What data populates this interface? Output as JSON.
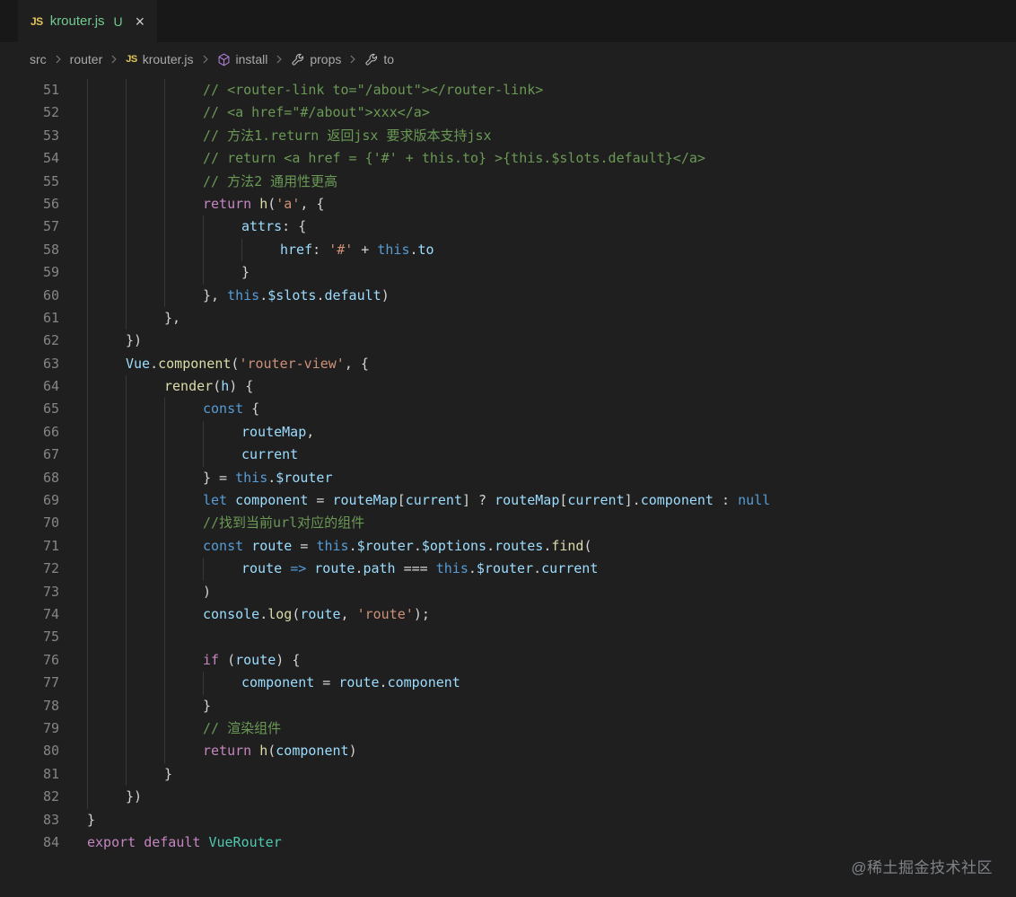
{
  "tab": {
    "icon_label": "JS",
    "title": "krouter.js",
    "git_badge": "U",
    "close_glyph": "×"
  },
  "breadcrumbs": [
    {
      "label": "src",
      "icon": null
    },
    {
      "label": "router",
      "icon": null
    },
    {
      "label": "krouter.js",
      "icon": "js"
    },
    {
      "label": "install",
      "icon": "cube"
    },
    {
      "label": "props",
      "icon": "wrench"
    },
    {
      "label": "to",
      "icon": "wrench"
    }
  ],
  "editor": {
    "first_line": 51,
    "last_line": 84,
    "lines": [
      {
        "n": 51,
        "i": 3,
        "t": [
          [
            "c",
            "// <router-link to=\"/about\"></router-link>"
          ]
        ]
      },
      {
        "n": 52,
        "i": 3,
        "t": [
          [
            "c",
            "// <a href=\"#/about\">xxx</a>"
          ]
        ]
      },
      {
        "n": 53,
        "i": 3,
        "t": [
          [
            "c",
            "// 方法1.return 返回jsx 要求版本支持jsx"
          ]
        ]
      },
      {
        "n": 54,
        "i": 3,
        "t": [
          [
            "c",
            "// return <a href = {'#' + this.to} >{this.$slots.default}</a>"
          ]
        ]
      },
      {
        "n": 55,
        "i": 3,
        "t": [
          [
            "c",
            "// 方法2 通用性更高"
          ]
        ]
      },
      {
        "n": 56,
        "i": 3,
        "t": [
          [
            "k",
            "return"
          ],
          [
            "p",
            " "
          ],
          [
            "f",
            "h"
          ],
          [
            "p",
            "("
          ],
          [
            "r",
            "'a'"
          ],
          [
            "p",
            ", {"
          ]
        ]
      },
      {
        "n": 57,
        "i": 4,
        "t": [
          [
            "v",
            "attrs"
          ],
          [
            "p",
            ": {"
          ]
        ]
      },
      {
        "n": 58,
        "i": 5,
        "t": [
          [
            "v",
            "href"
          ],
          [
            "p",
            ": "
          ],
          [
            "r",
            "'#'"
          ],
          [
            "p",
            " + "
          ],
          [
            "s",
            "this"
          ],
          [
            "p",
            "."
          ],
          [
            "v",
            "to"
          ]
        ]
      },
      {
        "n": 59,
        "i": 4,
        "t": [
          [
            "p",
            "}"
          ]
        ]
      },
      {
        "n": 60,
        "i": 3,
        "t": [
          [
            "p",
            "}, "
          ],
          [
            "s",
            "this"
          ],
          [
            "p",
            "."
          ],
          [
            "v",
            "$slots"
          ],
          [
            "p",
            "."
          ],
          [
            "v",
            "default"
          ],
          [
            "p",
            ")"
          ]
        ]
      },
      {
        "n": 61,
        "i": 2,
        "t": [
          [
            "p",
            "},"
          ]
        ]
      },
      {
        "n": 62,
        "i": 1,
        "t": [
          [
            "p",
            "})"
          ]
        ]
      },
      {
        "n": 63,
        "i": 1,
        "t": [
          [
            "v",
            "Vue"
          ],
          [
            "p",
            "."
          ],
          [
            "f",
            "component"
          ],
          [
            "p",
            "("
          ],
          [
            "r",
            "'router-view'"
          ],
          [
            "p",
            ", {"
          ]
        ]
      },
      {
        "n": 64,
        "i": 2,
        "t": [
          [
            "f",
            "render"
          ],
          [
            "p",
            "("
          ],
          [
            "v",
            "h"
          ],
          [
            "p",
            ") {"
          ]
        ]
      },
      {
        "n": 65,
        "i": 3,
        "t": [
          [
            "s",
            "const"
          ],
          [
            "p",
            " {"
          ]
        ]
      },
      {
        "n": 66,
        "i": 4,
        "t": [
          [
            "v",
            "routeMap"
          ],
          [
            "p",
            ","
          ]
        ]
      },
      {
        "n": 67,
        "i": 4,
        "t": [
          [
            "v",
            "current"
          ]
        ]
      },
      {
        "n": 68,
        "i": 3,
        "t": [
          [
            "p",
            "} = "
          ],
          [
            "s",
            "this"
          ],
          [
            "p",
            "."
          ],
          [
            "v",
            "$router"
          ]
        ]
      },
      {
        "n": 69,
        "i": 3,
        "t": [
          [
            "s",
            "let"
          ],
          [
            "p",
            " "
          ],
          [
            "v",
            "component"
          ],
          [
            "p",
            " = "
          ],
          [
            "v",
            "routeMap"
          ],
          [
            "p",
            "["
          ],
          [
            "v",
            "current"
          ],
          [
            "p",
            "] ? "
          ],
          [
            "v",
            "routeMap"
          ],
          [
            "p",
            "["
          ],
          [
            "v",
            "current"
          ],
          [
            "p",
            "]."
          ],
          [
            "v",
            "component"
          ],
          [
            "p",
            " : "
          ],
          [
            "s",
            "null"
          ]
        ]
      },
      {
        "n": 70,
        "i": 3,
        "t": [
          [
            "c",
            "//找到当前url对应的组件"
          ]
        ]
      },
      {
        "n": 71,
        "i": 3,
        "t": [
          [
            "s",
            "const"
          ],
          [
            "p",
            " "
          ],
          [
            "v",
            "route"
          ],
          [
            "p",
            " = "
          ],
          [
            "s",
            "this"
          ],
          [
            "p",
            "."
          ],
          [
            "v",
            "$router"
          ],
          [
            "p",
            "."
          ],
          [
            "v",
            "$options"
          ],
          [
            "p",
            "."
          ],
          [
            "v",
            "routes"
          ],
          [
            "p",
            "."
          ],
          [
            "f",
            "find"
          ],
          [
            "p",
            "("
          ]
        ]
      },
      {
        "n": 72,
        "i": 4,
        "t": [
          [
            "v",
            "route"
          ],
          [
            "p",
            " "
          ],
          [
            "s",
            "=>"
          ],
          [
            "p",
            " "
          ],
          [
            "v",
            "route"
          ],
          [
            "p",
            "."
          ],
          [
            "v",
            "path"
          ],
          [
            "p",
            " === "
          ],
          [
            "s",
            "this"
          ],
          [
            "p",
            "."
          ],
          [
            "v",
            "$router"
          ],
          [
            "p",
            "."
          ],
          [
            "v",
            "current"
          ]
        ]
      },
      {
        "n": 73,
        "i": 3,
        "t": [
          [
            "p",
            ")"
          ]
        ]
      },
      {
        "n": 74,
        "i": 3,
        "t": [
          [
            "v",
            "console"
          ],
          [
            "p",
            "."
          ],
          [
            "f",
            "log"
          ],
          [
            "p",
            "("
          ],
          [
            "v",
            "route"
          ],
          [
            "p",
            ", "
          ],
          [
            "r",
            "'route'"
          ],
          [
            "p",
            ");"
          ]
        ]
      },
      {
        "n": 75,
        "i": 3,
        "t": []
      },
      {
        "n": 76,
        "i": 3,
        "t": [
          [
            "k",
            "if"
          ],
          [
            "p",
            " ("
          ],
          [
            "v",
            "route"
          ],
          [
            "p",
            ") {"
          ]
        ]
      },
      {
        "n": 77,
        "i": 4,
        "t": [
          [
            "v",
            "component"
          ],
          [
            "p",
            " = "
          ],
          [
            "v",
            "route"
          ],
          [
            "p",
            "."
          ],
          [
            "v",
            "component"
          ]
        ]
      },
      {
        "n": 78,
        "i": 3,
        "t": [
          [
            "p",
            "}"
          ]
        ]
      },
      {
        "n": 79,
        "i": 3,
        "t": [
          [
            "c",
            "// 渲染组件"
          ]
        ]
      },
      {
        "n": 80,
        "i": 3,
        "t": [
          [
            "k",
            "return"
          ],
          [
            "p",
            " "
          ],
          [
            "f",
            "h"
          ],
          [
            "p",
            "("
          ],
          [
            "v",
            "component"
          ],
          [
            "p",
            ")"
          ]
        ]
      },
      {
        "n": 81,
        "i": 2,
        "t": [
          [
            "p",
            "}"
          ]
        ]
      },
      {
        "n": 82,
        "i": 1,
        "t": [
          [
            "p",
            "})"
          ]
        ]
      },
      {
        "n": 83,
        "i": 0,
        "t": [
          [
            "p",
            "}"
          ]
        ]
      },
      {
        "n": 84,
        "i": 0,
        "t": [
          [
            "k",
            "export"
          ],
          [
            "p",
            " "
          ],
          [
            "k",
            "default"
          ],
          [
            "p",
            " "
          ],
          [
            "l",
            "VueRouter"
          ]
        ]
      }
    ]
  },
  "watermark": "@稀土掘金技术社区",
  "colors": {
    "editor_background": "#1F1F1F",
    "tabbar_background": "#181818",
    "untracked_file_green": "#73C991",
    "comment": "#6A9955",
    "keyword_control": "#C586C0",
    "keyword_storage": "#569CD6",
    "string": "#CE9178",
    "function": "#DCDCAA",
    "variable": "#9CDCFE",
    "class": "#4EC9B0",
    "default_text": "#D4D4D4",
    "line_number": "#858585",
    "indent_guide": "#373737",
    "breadcrumb_text": "#A9A9A9",
    "namespace_icon_purple": "#B180D7",
    "js_icon_yellow": "#E2C55B"
  }
}
